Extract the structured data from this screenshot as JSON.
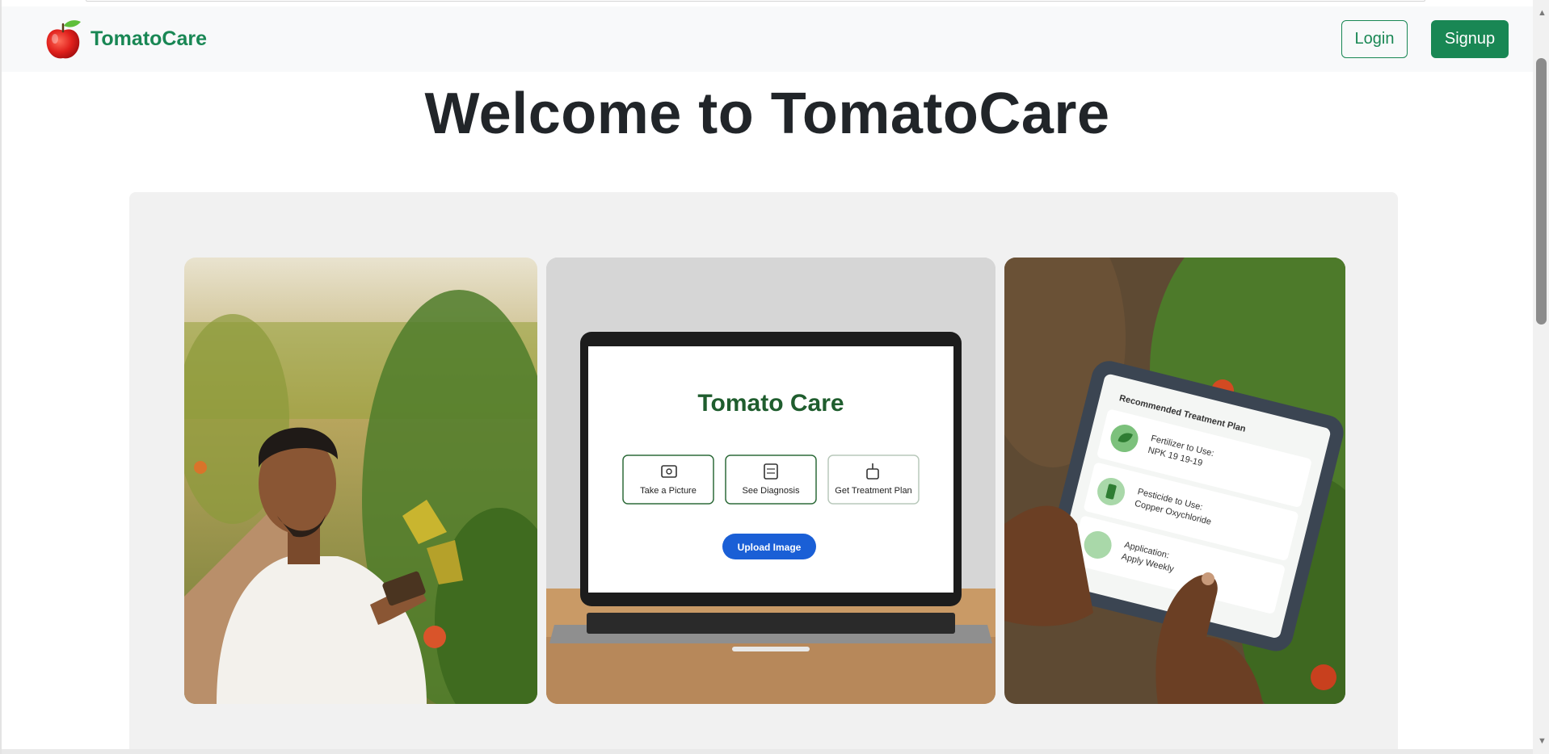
{
  "navbar": {
    "brand_name": "TomatoCare",
    "login_label": "Login",
    "signup_label": "Signup"
  },
  "main": {
    "title": "Welcome to TomatoCare"
  },
  "hero": {
    "laptop_screen": {
      "title": "Tomato Care",
      "options": [
        "Take a Picture",
        "See Diagnosis",
        "Get Treatment Plan"
      ],
      "upload_button": "Upload Image"
    },
    "tablet_screen": {
      "title": "Recommended Treatment Plan",
      "items": [
        {
          "line1": "Fertilizer to Use:",
          "line2": "NPK 19 19-19"
        },
        {
          "line1": "Pesticide to Use:",
          "line2": "Copper Oxychloride"
        },
        {
          "line1": "Application:",
          "line2": "Apply Weekly"
        }
      ]
    }
  },
  "colors": {
    "brand_green": "#198754",
    "title_dark": "#212529",
    "upload_blue": "#1a5fd6"
  },
  "icons": [
    "tomato-logo-icon",
    "camera-icon",
    "document-icon",
    "sprayer-icon",
    "leaf-icon",
    "bottle-icon"
  ]
}
